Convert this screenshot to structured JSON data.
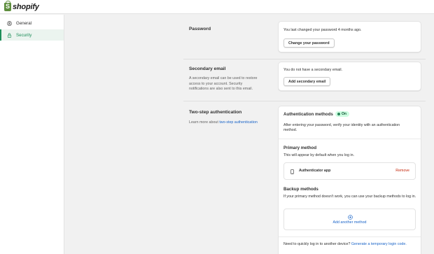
{
  "brand": {
    "name": "shopify"
  },
  "sidebar": {
    "items": [
      {
        "label": "General",
        "icon": "person-circle-icon",
        "active": false
      },
      {
        "label": "Security",
        "icon": "lock-icon",
        "active": true
      }
    ]
  },
  "password": {
    "title": "Password",
    "status": "You last changed your password 4 months ago.",
    "button": "Change your password"
  },
  "secondary_email": {
    "title": "Secondary email",
    "description": "A secondary email can be used to restore access to your account. Security notifications are also sent to this email.",
    "status": "You do not have a secondary email.",
    "button": "Add secondary email"
  },
  "two_step": {
    "title": "Two-step authentication",
    "learn_prefix": "Learn more about",
    "learn_link": "two-step authentication",
    "methods_title": "Authentication methods",
    "badge": "On",
    "methods_desc": "After entering your password, verify your identity with an authentication method.",
    "primary_title": "Primary method",
    "primary_desc": "This will appear by default when you log in.",
    "primary_method": "Authenticator app",
    "remove": "Remove",
    "backup_title": "Backup methods",
    "backup_desc": "If your primary method doesn't work, you can use your backup methods to log in.",
    "add_method": "Add another method",
    "footer_prefix": "Need to quickly log in to another device?",
    "footer_link": "Generate a temporary login code."
  },
  "colors": {
    "accent": "#1e8e5a",
    "link": "#1a64c8",
    "danger": "#c5280c",
    "badge_bg": "#cdfee1"
  }
}
